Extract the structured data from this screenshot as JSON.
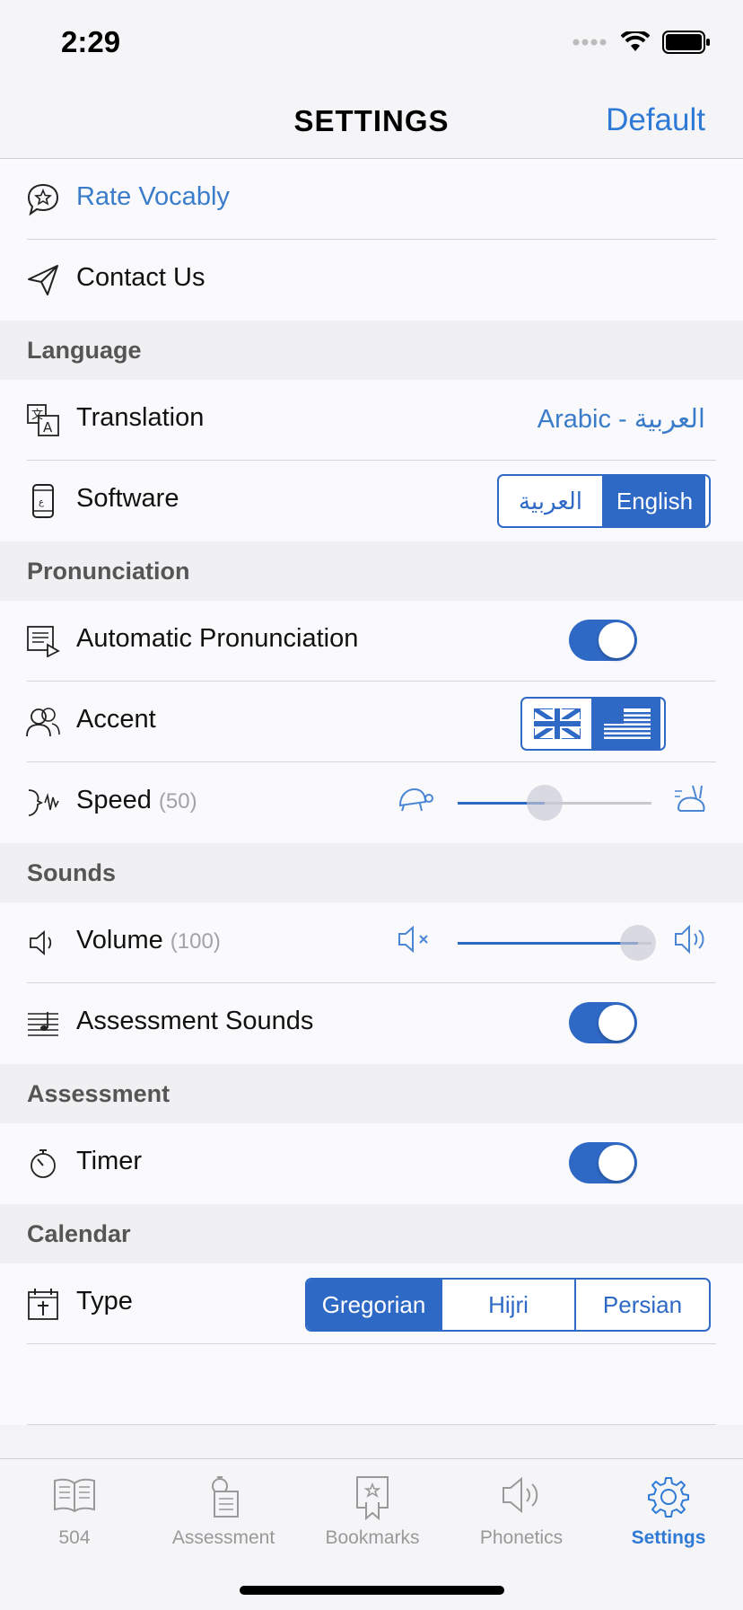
{
  "status": {
    "time": "2:29"
  },
  "nav": {
    "title": "SETTINGS",
    "default_label": "Default"
  },
  "rows": {
    "rate": {
      "label": "Rate Vocably"
    },
    "contact": {
      "label": "Contact Us"
    }
  },
  "sections": {
    "language": "Language",
    "pronunciation": "Pronunciation",
    "sounds": "Sounds",
    "assessment": "Assessment",
    "calendar": "Calendar"
  },
  "language": {
    "translation_label": "Translation",
    "translation_value": "Arabic - العربية",
    "software_label": "Software",
    "software_options": [
      "العربية",
      "English"
    ],
    "software_selected": "English"
  },
  "pronunciation": {
    "auto_label": "Automatic Pronunciation",
    "auto_on": true,
    "accent_label": "Accent",
    "accent_options": [
      "uk-flag",
      "us-flag"
    ],
    "accent_selected": "us-flag",
    "speed_label": "Speed",
    "speed_value": "(50)",
    "speed_level": 0.45
  },
  "sounds": {
    "volume_label": "Volume",
    "volume_value": "(100)",
    "volume_level": 0.93,
    "assessment_sounds_label": "Assessment Sounds",
    "assessment_sounds_on": true
  },
  "assessment": {
    "timer_label": "Timer",
    "timer_on": true
  },
  "calendar": {
    "type_label": "Type",
    "options": [
      "Gregorian",
      "Hijri",
      "Persian"
    ],
    "selected": "Gregorian"
  },
  "tabs": [
    {
      "label": "504",
      "icon": "book-icon"
    },
    {
      "label": "Assessment",
      "icon": "stopwatch-list-icon"
    },
    {
      "label": "Bookmarks",
      "icon": "bookmark-icon"
    },
    {
      "label": "Phonetics",
      "icon": "speaker-icon"
    },
    {
      "label": "Settings",
      "icon": "gear-icon",
      "active": true
    }
  ],
  "colors": {
    "accent": "#2f69c6",
    "link": "#2e7ad6",
    "section_bg": "#f0f0f2"
  }
}
